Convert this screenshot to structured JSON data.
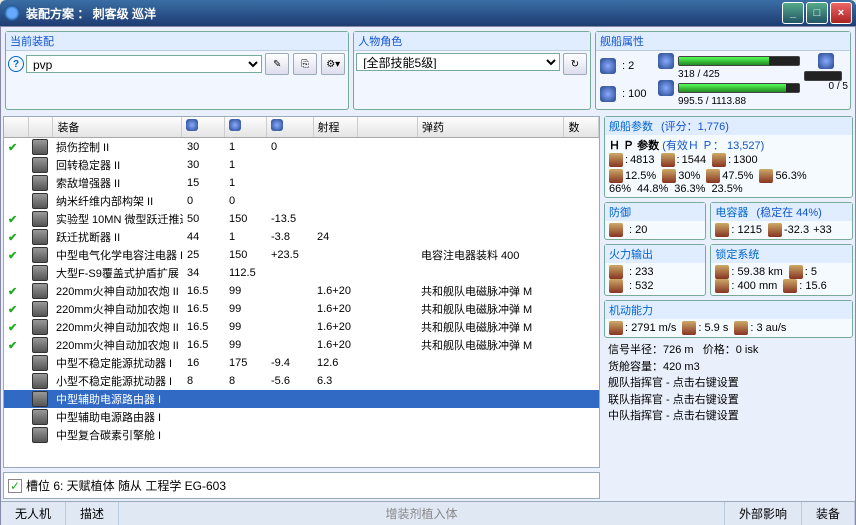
{
  "window": {
    "title": "装配方案 ： 刺客级 巡洋",
    "min": "_",
    "max": "□",
    "close": "×"
  },
  "current": {
    "header": "当前装配",
    "value": "pvp"
  },
  "char": {
    "header": "人物角色",
    "value": "[全部技能5级]"
  },
  "attr": {
    "header": "舰船属性",
    "turret": ": 2",
    "launcher": ": 100",
    "cal": "318 / 425",
    "pg": "995.5 / 1113.88",
    "rig": "0 / 5"
  },
  "cols": {
    "equip": "装备",
    "range": "射程",
    "ammo": "弹药",
    "qty": "数"
  },
  "rows": [
    {
      "on": true,
      "name": "损伤控制 II",
      "c1": "30",
      "c2": "1",
      "c3": "0"
    },
    {
      "on": false,
      "name": "回转稳定器 II",
      "c1": "30",
      "c2": "1"
    },
    {
      "on": false,
      "name": "索敌增强器 II",
      "c1": "15",
      "c2": "1"
    },
    {
      "on": false,
      "name": "纳米纤维内部构架 II",
      "c1": "0",
      "c2": "0"
    },
    {
      "on": true,
      "name": "实验型 10MN 微型跃迁推进器 I",
      "c1": "50",
      "c2": "150",
      "c3": "-13.5"
    },
    {
      "on": true,
      "name": "跃迁扰断器 II",
      "c1": "44",
      "c2": "1",
      "c3": "-3.8",
      "c4": "24"
    },
    {
      "on": true,
      "name": "中型电气化学电容注电器 I",
      "c1": "25",
      "c2": "150",
      "c3": "+23.5",
      "ammo": "电容注电器装料 400"
    },
    {
      "on": false,
      "name": "大型F-S9覆盖式护盾扩展",
      "c1": "34",
      "c2": "112.5"
    },
    {
      "on": true,
      "name": "220mm火神自动加农炮 II",
      "c1": "16.5",
      "c2": "99",
      "c4": "1.6+20",
      "ammo": "共和舰队电磁脉冲弹 M"
    },
    {
      "on": true,
      "name": "220mm火神自动加农炮 II",
      "c1": "16.5",
      "c2": "99",
      "c4": "1.6+20",
      "ammo": "共和舰队电磁脉冲弹 M"
    },
    {
      "on": true,
      "name": "220mm火神自动加农炮 II",
      "c1": "16.5",
      "c2": "99",
      "c4": "1.6+20",
      "ammo": "共和舰队电磁脉冲弹 M"
    },
    {
      "on": true,
      "name": "220mm火神自动加农炮 II",
      "c1": "16.5",
      "c2": "99",
      "c4": "1.6+20",
      "ammo": "共和舰队电磁脉冲弹 M"
    },
    {
      "on": false,
      "name": "中型不稳定能源扰动器 I",
      "c1": "16",
      "c2": "175",
      "c3": "-9.4",
      "c4": "12.6"
    },
    {
      "on": false,
      "name": "小型不稳定能源扰动器 I",
      "c1": "8",
      "c2": "8",
      "c3": "-5.6",
      "c4": "6.3"
    },
    {
      "on": false,
      "name": "中型辅助电源路由器 I",
      "sel": true
    },
    {
      "on": false,
      "name": "中型辅助电源路由器 I"
    },
    {
      "on": false,
      "name": "中型复合碳素引擎舱 I"
    }
  ],
  "slot": {
    "check": "✓",
    "text": "槽位 6: 天赋植体 随从 工程学 EG-603"
  },
  "tabs": {
    "drone": "无人机",
    "desc": "描述",
    "add": "增装剂植入体",
    "ext": "外部影响",
    "eq": "装备"
  },
  "params": {
    "header": "舰船参数",
    "rating_lbl": "(评分：",
    "rating": "1,776)",
    "hp_lbl": "Ｈ Ｐ 参数",
    "hp_eff_lbl": "(有效Ｈ Ｐ：",
    "hp_eff": "13,527)",
    "shield": "4813",
    "armor": "1544",
    "hull": "1300",
    "res": {
      "s1": "12.5%",
      "s2": "30%",
      "s3": "47.5%",
      "s4": "56.3%",
      "a1": "66%",
      "a2": "44.8%",
      "a3": "36.3%",
      "a4": "23.5%"
    }
  },
  "defense": {
    "header": "防御",
    "v1": ": 20"
  },
  "cap": {
    "header": "电容器",
    "stable_lbl": "(稳定在",
    "pct": "44%)",
    "v": ": 1215",
    "d1": "-32.3",
    "d2": "+33"
  },
  "fire": {
    "header": "火力输出",
    "v1": ": 233",
    "v2": ": 532"
  },
  "lock": {
    "header": "锁定系统",
    "r": ": 59.38 km",
    "n": ": 5",
    "s": ": 400 mm",
    "t": ": 15.6"
  },
  "mobility": {
    "header": "机动能力",
    "speed": ": 2791 m/s",
    "align": ": 5.9 s",
    "warp": ": 3 au/s"
  },
  "misc": {
    "sig_lbl": "信号半径：",
    "sig": "726 m",
    "price_lbl": "价格：",
    "price": "0 isk",
    "cargo_lbl": "货舱容量：",
    "cargo": "420 m3",
    "fc1": "舰队指挥官 - 点击右键设置",
    "fc2": "联队指挥官 - 点击右键设置",
    "fc3": "中队指挥官 - 点击右键设置"
  }
}
